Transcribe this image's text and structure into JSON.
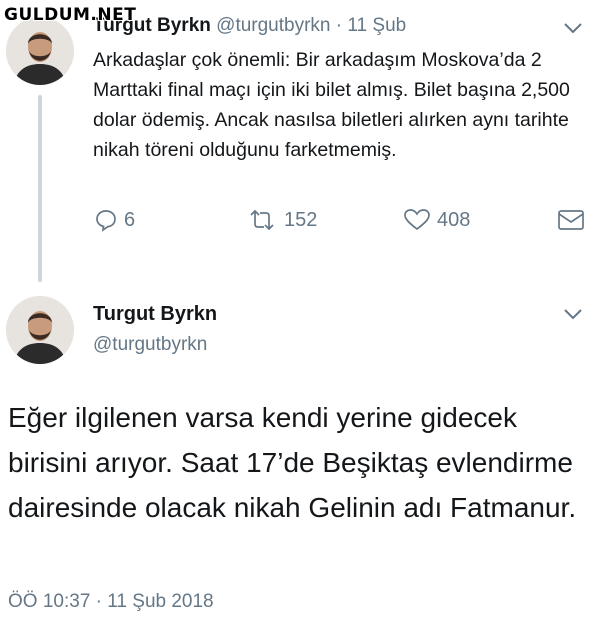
{
  "watermark": "GULDUM.NET",
  "tweet1": {
    "name": "Turgut Byrkn",
    "handle": "@turgutbyrkn",
    "separator": "·",
    "date": "11 Şub",
    "text": "Arkadaşlar çok önemli: Bir arkadaşım Moskova’da 2 Marttaki final maçı için iki bilet almış. Bilet başına 2,500 dolar ödemiş. Ancak nasılsa biletleri alırken aynı tarihte nikah töreni olduğunu farketmemiş.",
    "replies": "6",
    "retweets": "152",
    "likes": "408",
    "icons": [
      "reply-icon",
      "retweet-icon",
      "like-icon",
      "message-icon",
      "chevron-down-icon"
    ]
  },
  "tweet2": {
    "name": "Turgut Byrkn",
    "handle": "@turgutbyrkn",
    "text": "Eğer ilgilenen varsa kendi yerine gidecek birisini arıyor. Saat 17’de Beşiktaş evlendirme dairesinde olacak nikah Gelinin adı Fatmanur.",
    "timestamp": "ÖÖ 10:37 · 11 Şub 2018"
  },
  "colors": {
    "text": "#14171a",
    "muted": "#657786",
    "line": "#ccd6dd"
  }
}
